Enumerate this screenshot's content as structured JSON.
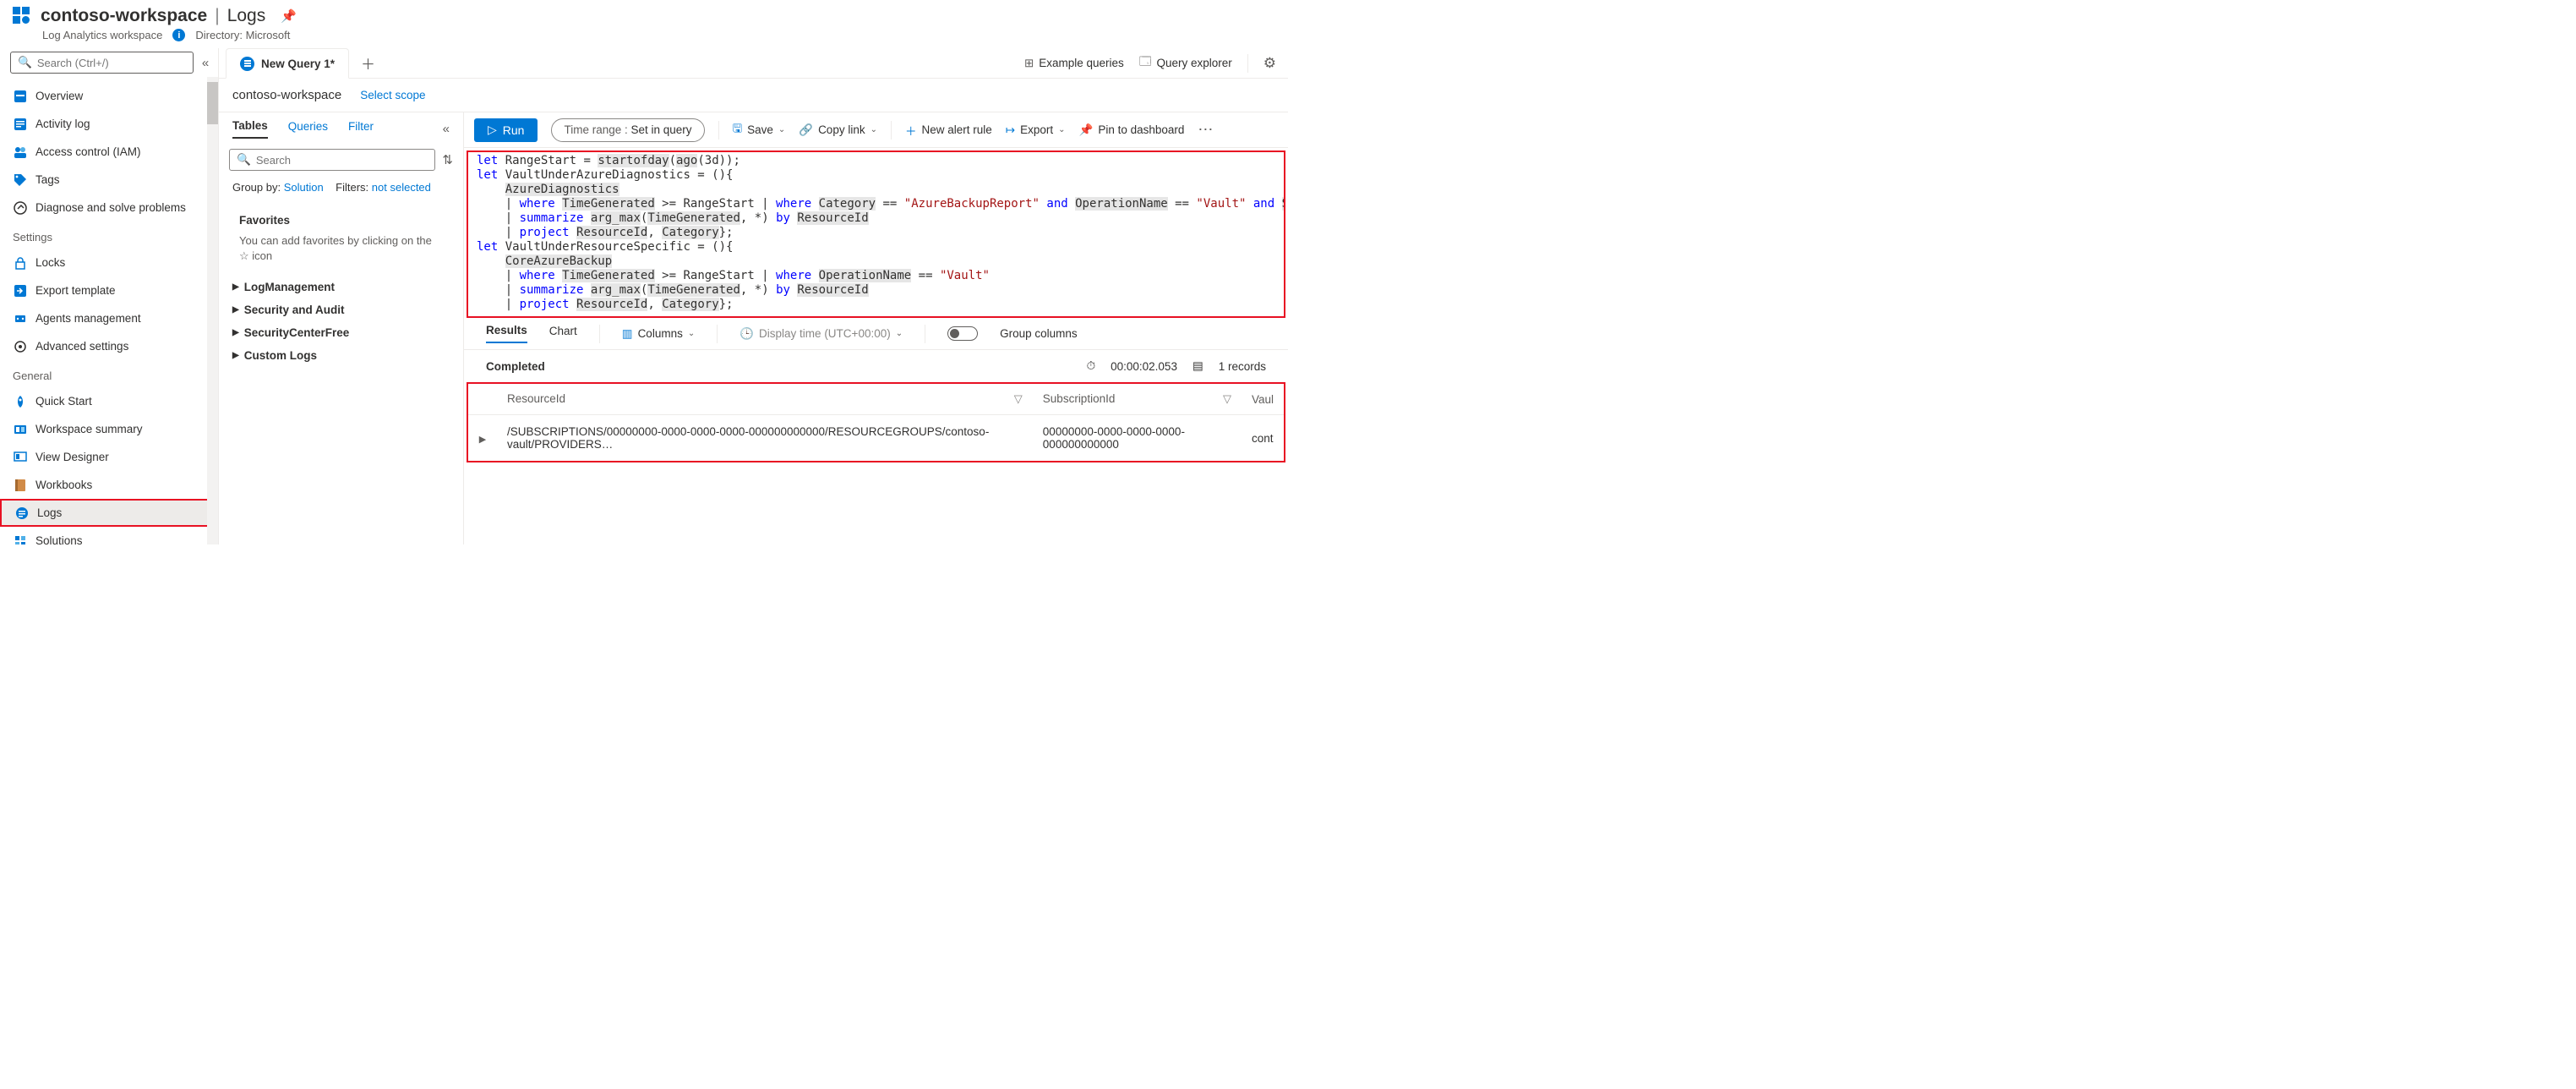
{
  "header": {
    "workspace_name": "contoso-workspace",
    "section": "Logs",
    "subtitle": "Log Analytics workspace",
    "directory_label": "Directory: Microsoft"
  },
  "sidebar": {
    "search_placeholder": "Search (Ctrl+/)",
    "items_top": [
      {
        "label": "Overview",
        "icon": "overview"
      },
      {
        "label": "Activity log",
        "icon": "activity"
      },
      {
        "label": "Access control (IAM)",
        "icon": "iam"
      },
      {
        "label": "Tags",
        "icon": "tags"
      },
      {
        "label": "Diagnose and solve problems",
        "icon": "diagnose"
      }
    ],
    "section_settings": "Settings",
    "items_settings": [
      {
        "label": "Locks",
        "icon": "locks"
      },
      {
        "label": "Export template",
        "icon": "export"
      },
      {
        "label": "Agents management",
        "icon": "agents"
      },
      {
        "label": "Advanced settings",
        "icon": "advsettings"
      }
    ],
    "section_general": "General",
    "items_general": [
      {
        "label": "Quick Start",
        "icon": "quick"
      },
      {
        "label": "Workspace summary",
        "icon": "summary"
      },
      {
        "label": "View Designer",
        "icon": "designer"
      },
      {
        "label": "Workbooks",
        "icon": "workbooks"
      },
      {
        "label": "Logs",
        "icon": "logs",
        "active": true,
        "highlight": true
      },
      {
        "label": "Solutions",
        "icon": "solutions"
      }
    ]
  },
  "tabs": {
    "query_tab": "New Query 1*",
    "example_queries": "Example queries",
    "query_explorer": "Query explorer"
  },
  "scope": {
    "workspace": "contoso-workspace",
    "select_scope": "Select scope"
  },
  "left_panel": {
    "tabs": {
      "tables": "Tables",
      "queries": "Queries",
      "filter": "Filter"
    },
    "search_placeholder": "Search",
    "group_by_label": "Group by:",
    "group_by_value": "Solution",
    "filters_label": "Filters:",
    "filters_value": "not selected",
    "favorites_title": "Favorites",
    "favorites_hint_pre": "You can add favorites by clicking on the ",
    "favorites_hint_post": " icon",
    "tree": [
      "LogManagement",
      "Security and Audit",
      "SecurityCenterFree",
      "Custom Logs"
    ]
  },
  "toolbar": {
    "run": "Run",
    "time_label": "Time range :",
    "time_value": "Set in query",
    "save": "Save",
    "copy_link": "Copy link",
    "new_alert": "New alert rule",
    "export": "Export",
    "pin": "Pin to dashboard"
  },
  "editor": {
    "lines": [
      [
        {
          "t": "let",
          "c": "kw"
        },
        {
          "t": " RangeStart = "
        },
        {
          "t": "startofday",
          "h": true
        },
        {
          "t": "("
        },
        {
          "t": "ago",
          "h": true
        },
        {
          "t": "(3d));"
        }
      ],
      [
        {
          "t": "let",
          "c": "kw"
        },
        {
          "t": " VaultUnderAzureDiagnostics = (){"
        }
      ],
      [
        {
          "t": "    "
        },
        {
          "t": "AzureDiagnostics",
          "h": true
        }
      ],
      [
        {
          "t": "    | "
        },
        {
          "t": "where",
          "c": "kw"
        },
        {
          "t": " "
        },
        {
          "t": "TimeGenerated",
          "h": true
        },
        {
          "t": " >= RangeStart | "
        },
        {
          "t": "where",
          "c": "kw"
        },
        {
          "t": " "
        },
        {
          "t": "Category",
          "h": true
        },
        {
          "t": " == "
        },
        {
          "t": "\"AzureBackupReport\"",
          "c": "str"
        },
        {
          "t": " "
        },
        {
          "t": "and",
          "c": "kw"
        },
        {
          "t": " "
        },
        {
          "t": "OperationName",
          "h": true
        },
        {
          "t": " == "
        },
        {
          "t": "\"Vault\"",
          "c": "str"
        },
        {
          "t": " "
        },
        {
          "t": "and",
          "c": "kw"
        },
        {
          "t": " "
        },
        {
          "t": "SchemaVer",
          "h": true
        }
      ],
      [
        {
          "t": "    | "
        },
        {
          "t": "summarize",
          "c": "kw"
        },
        {
          "t": " "
        },
        {
          "t": "arg_max",
          "h": true
        },
        {
          "t": "("
        },
        {
          "t": "TimeGenerated",
          "h": true
        },
        {
          "t": ", *) "
        },
        {
          "t": "by",
          "c": "kw"
        },
        {
          "t": " "
        },
        {
          "t": "ResourceId",
          "h": true
        }
      ],
      [
        {
          "t": "    | "
        },
        {
          "t": "project",
          "c": "kw"
        },
        {
          "t": " "
        },
        {
          "t": "ResourceId",
          "h": true
        },
        {
          "t": ", "
        },
        {
          "t": "Category",
          "h": true
        },
        {
          "t": "};"
        }
      ],
      [
        {
          "t": "let",
          "c": "kw"
        },
        {
          "t": " VaultUnderResourceSpecific = (){"
        }
      ],
      [
        {
          "t": "    "
        },
        {
          "t": "CoreAzureBackup",
          "h": true
        }
      ],
      [
        {
          "t": "    | "
        },
        {
          "t": "where",
          "c": "kw"
        },
        {
          "t": " "
        },
        {
          "t": "TimeGenerated",
          "h": true
        },
        {
          "t": " >= RangeStart | "
        },
        {
          "t": "where",
          "c": "kw"
        },
        {
          "t": " "
        },
        {
          "t": "OperationName",
          "h": true
        },
        {
          "t": " == "
        },
        {
          "t": "\"Vault\"",
          "c": "str"
        }
      ],
      [
        {
          "t": "    | "
        },
        {
          "t": "summarize",
          "c": "kw"
        },
        {
          "t": " "
        },
        {
          "t": "arg_max",
          "h": true
        },
        {
          "t": "("
        },
        {
          "t": "TimeGenerated",
          "h": true
        },
        {
          "t": ", *) "
        },
        {
          "t": "by",
          "c": "kw"
        },
        {
          "t": " "
        },
        {
          "t": "ResourceId",
          "h": true
        }
      ],
      [
        {
          "t": "    | "
        },
        {
          "t": "project",
          "c": "kw"
        },
        {
          "t": " "
        },
        {
          "t": "ResourceId",
          "h": true
        },
        {
          "t": ", "
        },
        {
          "t": "Category",
          "h": true
        },
        {
          "t": "};"
        }
      ]
    ]
  },
  "results": {
    "tab_results": "Results",
    "tab_chart": "Chart",
    "columns": "Columns",
    "display_time": "Display time (UTC+00:00)",
    "group_columns": "Group columns",
    "status": "Completed",
    "duration": "00:00:02.053",
    "record_count": "1 records",
    "headers": [
      "ResourceId",
      "SubscriptionId",
      "Vaul"
    ],
    "row": {
      "resource_id": "/SUBSCRIPTIONS/00000000-0000-0000-0000-000000000000/RESOURCEGROUPS/contoso-vault/PROVIDERS…",
      "subscription_id": "00000000-0000-0000-0000-000000000000",
      "vault": "cont"
    }
  }
}
